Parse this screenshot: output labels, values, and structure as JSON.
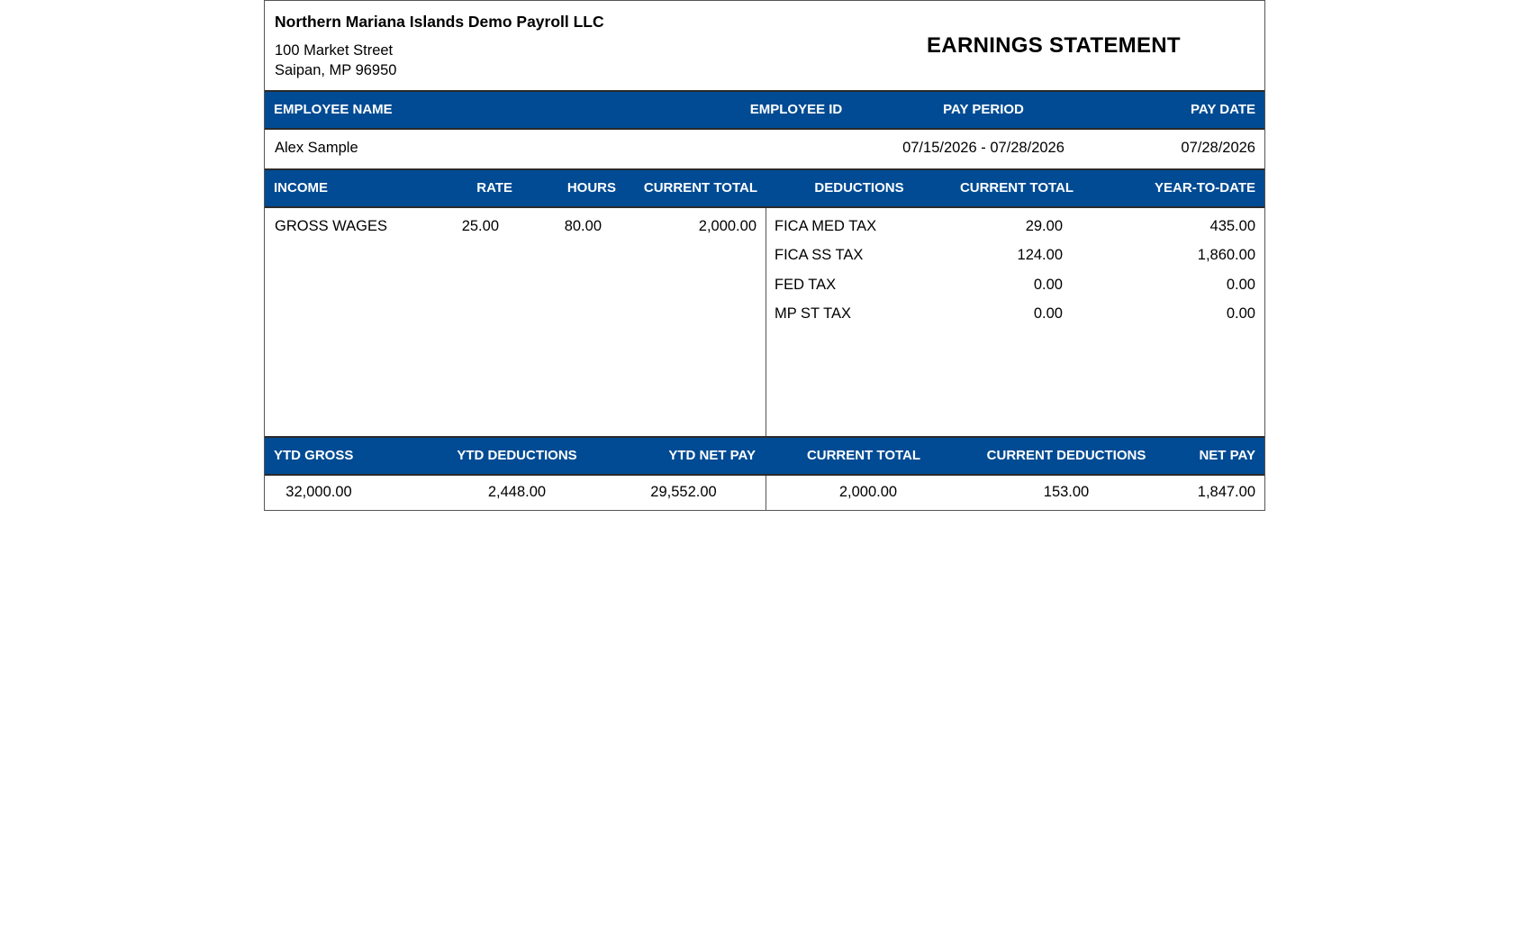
{
  "company": {
    "name": "Northern Mariana Islands Demo Payroll LLC",
    "address_line1": "100 Market Street",
    "address_line2": "Saipan, MP 96950"
  },
  "document_title": "EARNINGS STATEMENT",
  "employee_header": {
    "name_label": "EMPLOYEE NAME",
    "id_label": "EMPLOYEE ID",
    "period_label": "PAY PERIOD",
    "date_label": "PAY DATE"
  },
  "employee": {
    "name": "Alex Sample",
    "id": "",
    "pay_period": "07/15/2026 - 07/28/2026",
    "pay_date": "07/28/2026"
  },
  "detail_header": {
    "income": "INCOME",
    "rate": "RATE",
    "hours": "HOURS",
    "current_total": "CURRENT TOTAL",
    "deductions": "DEDUCTIONS",
    "ded_current_total": "CURRENT TOTAL",
    "ytd": "YEAR-TO-DATE"
  },
  "income": [
    {
      "label": "GROSS WAGES",
      "rate": "25.00",
      "hours": "80.00",
      "current_total": "2,000.00"
    }
  ],
  "deductions": [
    {
      "label": "FICA MED TAX",
      "current_total": "29.00",
      "ytd": "435.00"
    },
    {
      "label": "FICA SS TAX",
      "current_total": "124.00",
      "ytd": "1,860.00"
    },
    {
      "label": "FED TAX",
      "current_total": "0.00",
      "ytd": "0.00"
    },
    {
      "label": "MP ST TAX",
      "current_total": "0.00",
      "ytd": "0.00"
    }
  ],
  "summary_header": {
    "ytd_gross": "YTD GROSS",
    "ytd_deductions": "YTD DEDUCTIONS",
    "ytd_net_pay": "YTD NET PAY",
    "current_total": "CURRENT TOTAL",
    "current_deductions": "CURRENT DEDUCTIONS",
    "net_pay": "NET PAY"
  },
  "summary": {
    "ytd_gross": "32,000.00",
    "ytd_deductions": "2,448.00",
    "ytd_net_pay": "29,552.00",
    "current_total": "2,000.00",
    "current_deductions": "153.00",
    "net_pay": "1,847.00"
  },
  "colors": {
    "header_band": "#004b93",
    "border": "#555555"
  }
}
